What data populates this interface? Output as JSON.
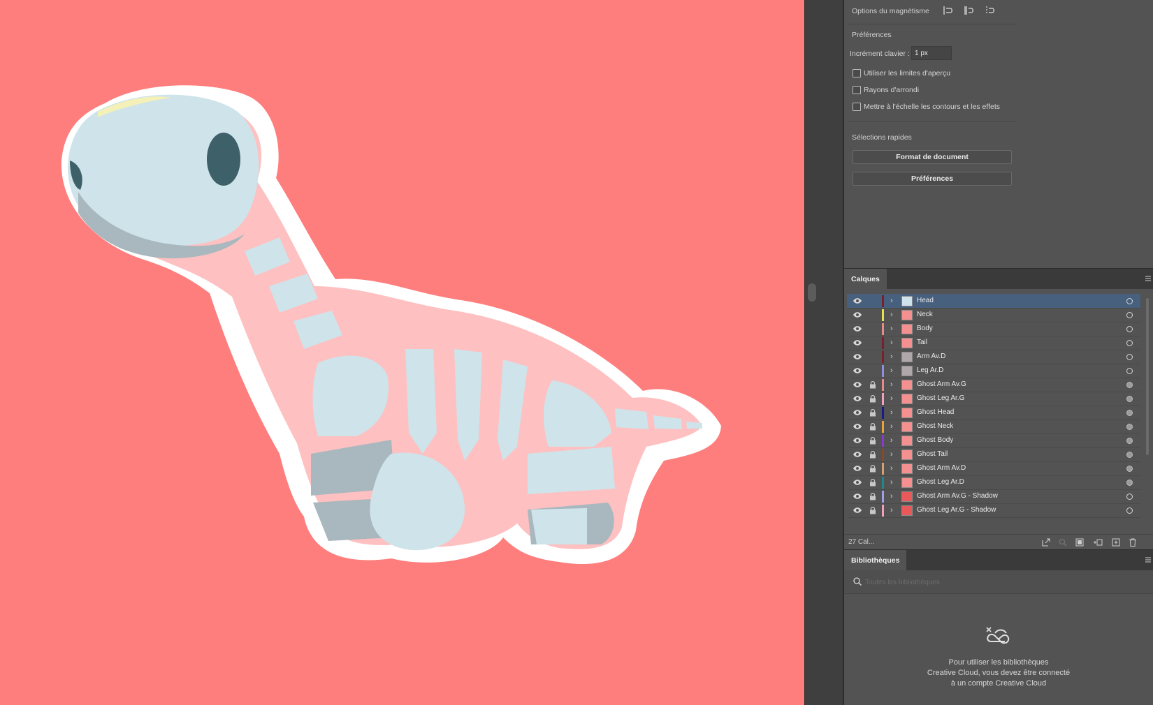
{
  "panel": {
    "snap": {
      "title": "Options du magnétisme",
      "icons": [
        "snap-to-point-icon",
        "snap-to-pixel-icon",
        "snap-to-grid-icon"
      ]
    },
    "preferences": {
      "title": "Préférences",
      "keyboard_increment_label": "Incrément clavier :",
      "keyboard_increment_value": "1 px",
      "checkboxes": [
        {
          "label": "Utiliser les limites d'aperçu",
          "checked": false
        },
        {
          "label": "Rayons d'arrondi",
          "checked": false
        },
        {
          "label": "Mettre à l'échelle les contours et les effets",
          "checked": false
        }
      ]
    },
    "quick_actions": {
      "title": "Sélections rapides",
      "document_setup_label": "Format de document",
      "preferences_label": "Préférences"
    }
  },
  "layers": {
    "tab_label": "Calques",
    "count_label": "27 Cal...",
    "items": [
      {
        "name": "Head",
        "color": "#7a1f2e",
        "locked": false,
        "selected": true,
        "thumb": "#cfe3ea"
      },
      {
        "name": "Neck",
        "color": "#e8e24a",
        "locked": false,
        "selected": false,
        "thumb": "#f49190"
      },
      {
        "name": "Body",
        "color": "#e98a8a",
        "locked": false,
        "selected": false,
        "thumb": "#f49190"
      },
      {
        "name": "Tail",
        "color": "#7a1f2e",
        "locked": false,
        "selected": false,
        "thumb": "#f49190"
      },
      {
        "name": "Arm Av.D",
        "color": "#7a1f2e",
        "locked": false,
        "selected": false,
        "thumb": "#b0a7ab"
      },
      {
        "name": "Leg Ar.D",
        "color": "#8f8fe0",
        "locked": false,
        "selected": false,
        "thumb": "#b0a7ab"
      },
      {
        "name": "Ghost Arm Av.G",
        "color": "#e98a8a",
        "locked": true,
        "selected": false,
        "thumb": "#f49190"
      },
      {
        "name": "Ghost Leg Ar.G",
        "color": "#f2a0c0",
        "locked": true,
        "selected": false,
        "thumb": "#f49190"
      },
      {
        "name": "Ghost Head",
        "color": "#1a1a8a",
        "locked": true,
        "selected": false,
        "thumb": "#f49190"
      },
      {
        "name": "Ghost Neck",
        "color": "#e8a33a",
        "locked": true,
        "selected": false,
        "thumb": "#f49190"
      },
      {
        "name": "Ghost Body",
        "color": "#8a3ad0",
        "locked": true,
        "selected": false,
        "thumb": "#f49190"
      },
      {
        "name": "Ghost Tail",
        "color": "#8a4a2a",
        "locked": true,
        "selected": false,
        "thumb": "#f49190"
      },
      {
        "name": "Ghost Arm Av.D",
        "color": "#d8a070",
        "locked": true,
        "selected": false,
        "thumb": "#f49190"
      },
      {
        "name": "Ghost Leg Ar.D",
        "color": "#1a8a8a",
        "locked": true,
        "selected": false,
        "thumb": "#f49190"
      },
      {
        "name": "Ghost Arm Av.G - Shadow",
        "color": "#a0a0e8",
        "locked": true,
        "selected": false,
        "thumb": "#e85a5a"
      },
      {
        "name": "Ghost Leg Ar.G - Shadow",
        "color": "#f2a0c0",
        "locked": true,
        "selected": false,
        "thumb": "#e85a5a"
      }
    ]
  },
  "libraries": {
    "tab_label": "Bibliothèques",
    "search_placeholder": "Toutes les bibliothèques",
    "message_line1": "Pour utiliser les bibliothèques",
    "message_line2": "Creative Cloud, vous devez être connecté",
    "message_line3": "à un compte Creative Cloud"
  },
  "colors": {
    "canvas": "#fe7e7d",
    "selection": "#46607e",
    "panel": "#535353"
  }
}
